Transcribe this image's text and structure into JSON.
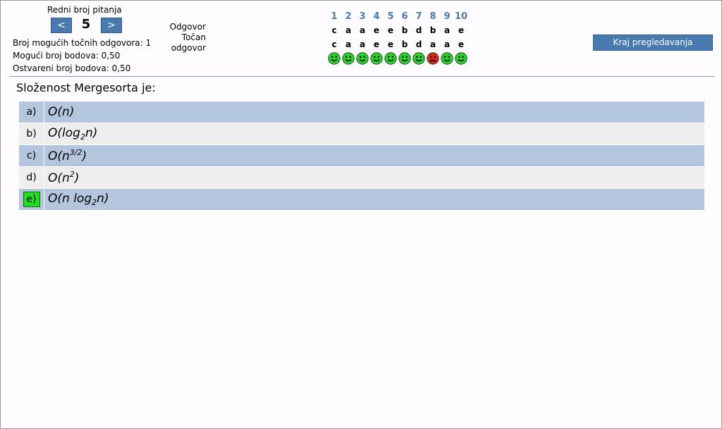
{
  "header": {
    "redni_label": "Redni broj pitanja",
    "prev_label": "<",
    "next_label": ">",
    "question_number": "5",
    "possible_correct": "Broj mogućih točnih odgovora: 1",
    "possible_points": "Mogući broj bodova: 0,50",
    "earned_points": "Ostvareni broj bodova: 0,50",
    "legend_answer": "Odgovor",
    "legend_correct_1": "Točan",
    "legend_correct_2": "odgovor",
    "finish_label": "Kraj pregledavanja"
  },
  "grid": {
    "numbers": [
      "1",
      "2",
      "3",
      "4",
      "5",
      "6",
      "7",
      "8",
      "9",
      "10"
    ],
    "answers": [
      "c",
      "a",
      "a",
      "e",
      "e",
      "b",
      "d",
      "b",
      "a",
      "e"
    ],
    "correct": [
      "c",
      "a",
      "a",
      "e",
      "e",
      "b",
      "d",
      "a",
      "a",
      "e"
    ],
    "results": [
      "happy",
      "happy",
      "happy",
      "happy",
      "happy",
      "happy",
      "happy",
      "sad",
      "happy",
      "happy"
    ]
  },
  "colors": {
    "accent": "#4a7bb0",
    "row_blue": "#b3c6dd",
    "row_gray": "#eeeeee",
    "correct_green": "#22dd22",
    "smiley_green": "#33cc33",
    "smiley_red": "#dd2222"
  },
  "question": {
    "text": "Složenost Mergesorta je:",
    "options": [
      {
        "letter": "a)",
        "pre": "O(n)"
      },
      {
        "letter": "b)",
        "pre": "O(log",
        "sub": "2",
        "post": "n)"
      },
      {
        "letter": "c)",
        "pre": "O(n",
        "sup": "3/2",
        "post": ")"
      },
      {
        "letter": "d)",
        "pre": "O(n",
        "sup": "2",
        "post": ")"
      },
      {
        "letter": "e)",
        "pre": "O(n log",
        "sub": "2",
        "post": "n)",
        "correct": true
      }
    ]
  }
}
